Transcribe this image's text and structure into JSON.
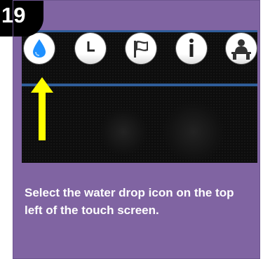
{
  "step": {
    "number": "19"
  },
  "toolbar": {
    "icons": [
      "water-drop-icon",
      "clock-icon",
      "flag-icon",
      "info-icon",
      "operator-icon"
    ]
  },
  "instruction": {
    "text": "Select the  water drop icon on the top left of the touch screen."
  },
  "colors": {
    "card_background": "#8064a2",
    "screen_background": "#0d0d0d",
    "accent_bar": "#2f5d99",
    "arrow": "#ffff00",
    "water_drop": "#1e90ff"
  }
}
